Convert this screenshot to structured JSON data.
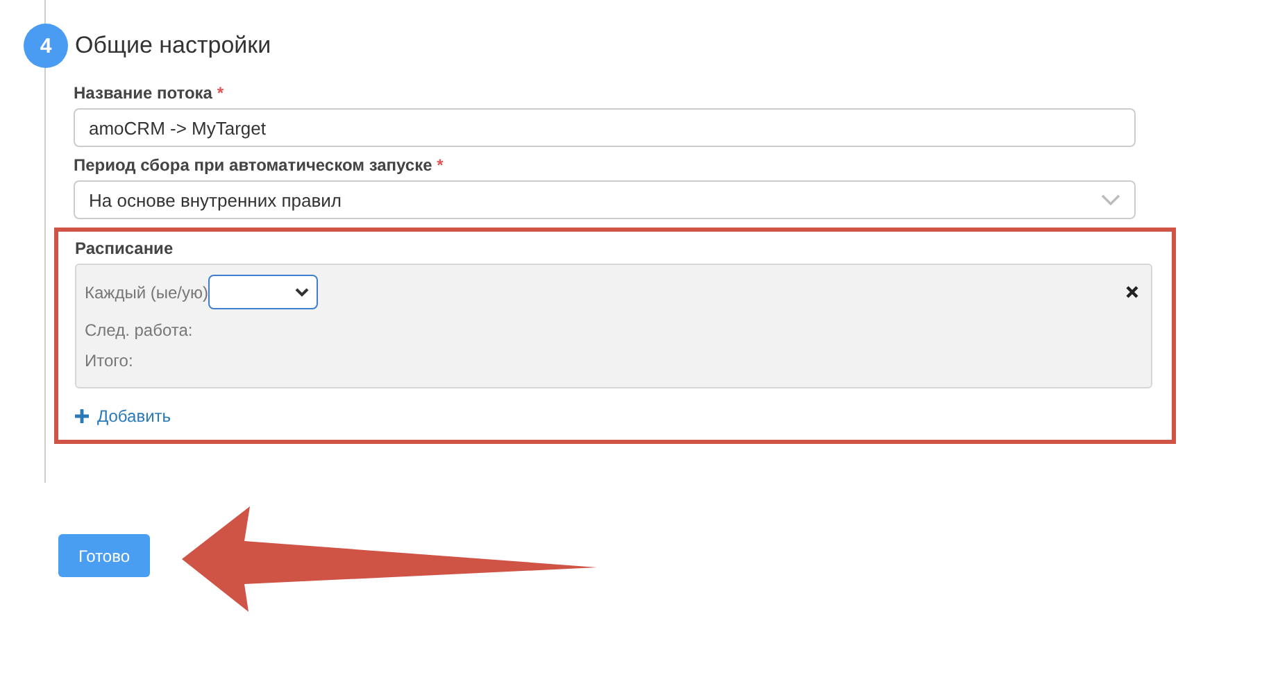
{
  "step": {
    "number": "4",
    "title": "Общие настройки"
  },
  "fields": [
    {
      "kind": "text",
      "label": "Название потока",
      "mark": "*",
      "value": "amoCRM -> MyTarget"
    },
    {
      "kind": "select",
      "label": "Период сбора при автоматическом запуске",
      "mark": "*",
      "value": "На основе внутренних правил"
    }
  ],
  "schedule": {
    "label": "Расписание",
    "highlighted": true,
    "entries": [
      {
        "every_label": "Каждый (ые/ую)",
        "next_label": "След. работа:",
        "total_label": "Итого:"
      }
    ],
    "add_link": "Добавить"
  },
  "done_button": "Готово"
}
